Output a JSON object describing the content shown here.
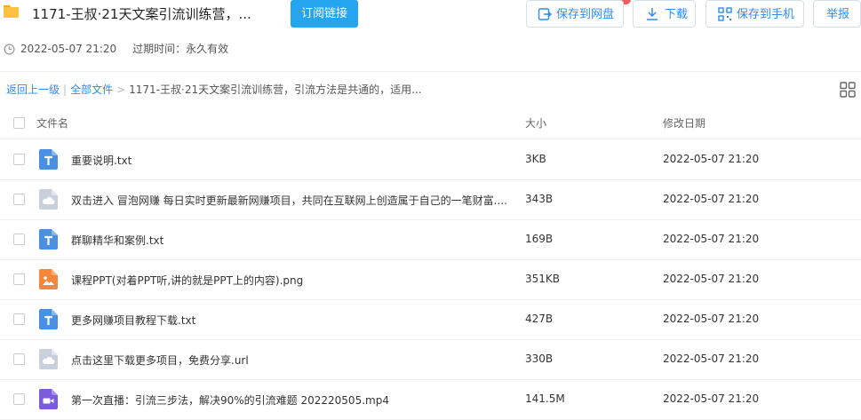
{
  "header": {
    "title": "1171-王叔·21天文案引流训练营，...",
    "subscribe_label": "订阅链接",
    "actions": {
      "save_pan": "保存到网盘",
      "download": "下载",
      "save_phone": "保存到手机",
      "report": "举报"
    }
  },
  "meta": {
    "created": "2022-05-07 21:20",
    "expire": "过期时间：永久有效"
  },
  "breadcrumb": {
    "back": "返回上一级",
    "sep1": "|",
    "all_files": "全部文件",
    "sep2": ">",
    "current": "1171-王叔·21天文案引流训练营，引流方法是共通的，适用..."
  },
  "table": {
    "headers": {
      "name": "文件名",
      "size": "大小",
      "date": "修改日期"
    },
    "rows": [
      {
        "icon": "txt-file-icon",
        "name": "重要说明.txt",
        "size": "3KB",
        "date": "2022-05-07 21:20"
      },
      {
        "icon": "cloud-file-icon",
        "name": "双击进入 冒泡网赚 每日实时更新最新网赚项目，共同在互联网上创造属于自己的一笔财富....",
        "size": "343B",
        "date": "2022-05-07 21:20"
      },
      {
        "icon": "txt-file-icon",
        "name": "群聊精华和案例.txt",
        "size": "169B",
        "date": "2022-05-07 21:20"
      },
      {
        "icon": "image-file-icon",
        "name": "课程PPT(对着PPT听,讲的就是PPT上的内容).png",
        "size": "351KB",
        "date": "2022-05-07 21:20"
      },
      {
        "icon": "txt-file-icon",
        "name": "更多网赚项目教程下载.txt",
        "size": "427B",
        "date": "2022-05-07 21:20"
      },
      {
        "icon": "cloud-file-icon",
        "name": "点击这里下载更多项目，免费分享.url",
        "size": "330B",
        "date": "2022-05-07 21:20"
      },
      {
        "icon": "video-file-icon",
        "name": "第一次直播：引流三步法，解决90%的引流难题 202220505.mp4",
        "size": "141.5M",
        "date": "2022-05-07 21:20"
      }
    ]
  },
  "colors": {
    "accent": "#2d8cf0",
    "subscribe_bg": "#26a5ef",
    "txt_icon": "#4a90e2",
    "cloud_icon": "#c8d0db",
    "image_icon": "#f5863a",
    "video_icon": "#7b5ce1"
  }
}
